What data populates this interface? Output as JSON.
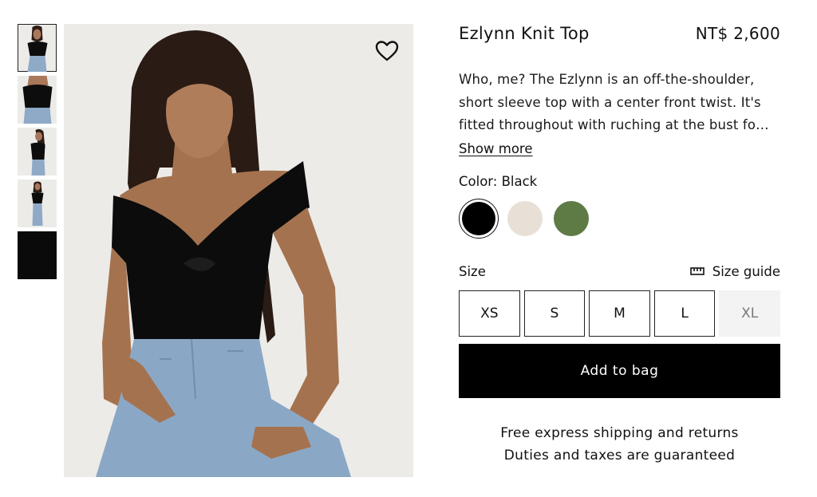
{
  "product": {
    "title": "Ezlynn Knit Top",
    "price": "NT$ 2,600",
    "description": "Who, me? The Ezlynn is an off-the-shoulder, short sleeve top with a center front twist. It's fitted throughout with ruching at the bust fo…",
    "show_more_label": "Show more"
  },
  "gallery": {
    "thumbnails": [
      "model-front",
      "model-closeup",
      "model-side",
      "model-full",
      "fabric-black"
    ],
    "selected_index": 0
  },
  "wishlist": {
    "icon": "heart-icon"
  },
  "color": {
    "label": "Color: Black",
    "swatches": [
      {
        "name": "Black",
        "hex": "#000000",
        "selected": true
      },
      {
        "name": "Cream",
        "hex": "#e8e0d6",
        "selected": false
      },
      {
        "name": "Green",
        "hex": "#5e7b46",
        "selected": false
      }
    ]
  },
  "size": {
    "label": "Size",
    "guide_label": "Size guide",
    "guide_icon": "ruler-icon",
    "options": [
      {
        "label": "XS",
        "available": true
      },
      {
        "label": "S",
        "available": true
      },
      {
        "label": "M",
        "available": true
      },
      {
        "label": "L",
        "available": true
      },
      {
        "label": "XL",
        "available": false
      }
    ]
  },
  "cta": {
    "add_to_bag": "Add to bag"
  },
  "shipping": {
    "line1": "Free express shipping and returns",
    "line2": "Duties and taxes are guaranteed"
  }
}
